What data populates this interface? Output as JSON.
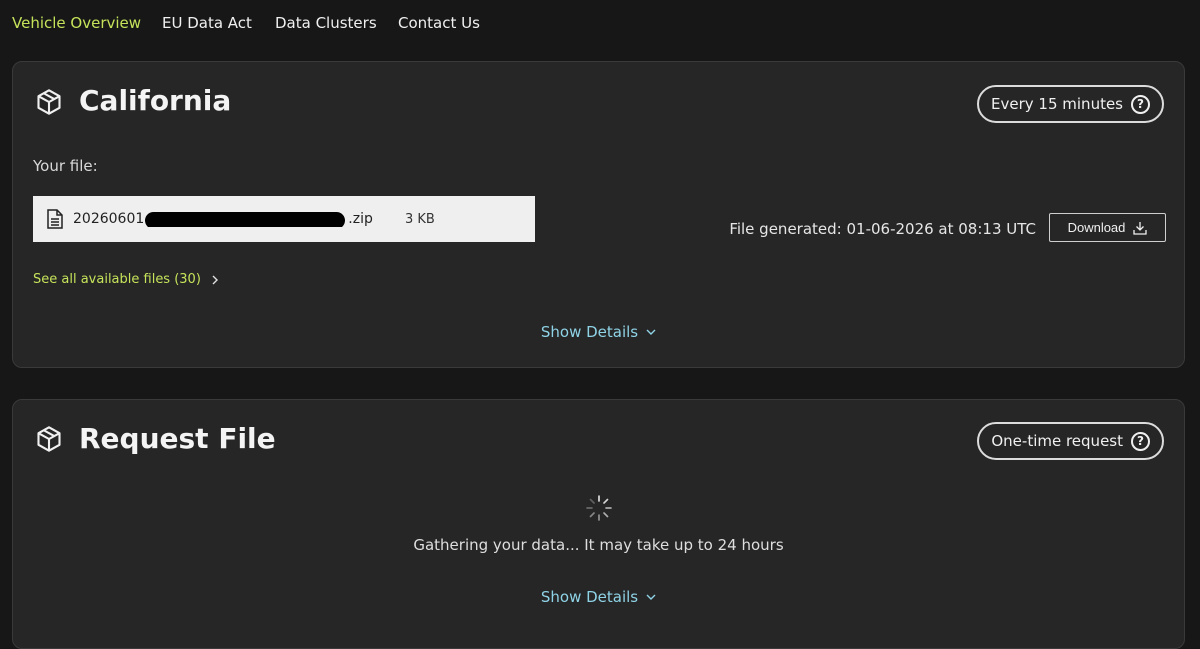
{
  "nav": {
    "items": [
      {
        "label": "Vehicle Overview",
        "active": true
      },
      {
        "label": "EU Data Act",
        "active": false
      },
      {
        "label": "Data Clusters",
        "active": false
      },
      {
        "label": "Contact Us",
        "active": false
      }
    ]
  },
  "colors": {
    "accent": "#c5e35a",
    "link": "#8fd3e6",
    "background": "#171717",
    "card": "#262626"
  },
  "california": {
    "title": "California",
    "frequency": "Every 15 minutes",
    "your_file_label": "Your file:",
    "file": {
      "name_prefix": "20260601",
      "name_suffix": ".zip",
      "size": "3 KB",
      "icon": "document-icon"
    },
    "generated": "File generated: 01-06-2026 at 08:13 UTC",
    "download_label": "Download",
    "see_all": "See all available files (30)",
    "show_details": "Show Details"
  },
  "request": {
    "title": "Request File",
    "frequency": "One-time request",
    "status": "Gathering your data... It may take up to 24 hours",
    "show_details": "Show Details"
  }
}
